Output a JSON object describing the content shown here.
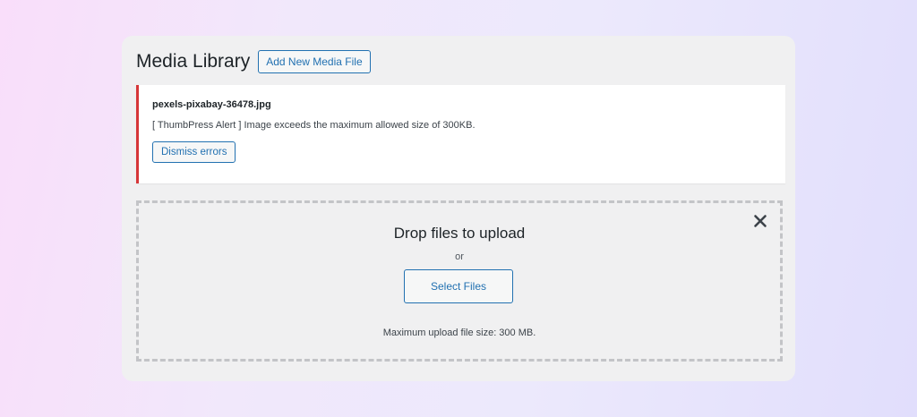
{
  "header": {
    "title": "Media Library",
    "add_new_label": "Add New Media File"
  },
  "notice": {
    "filename": "pexels-pixabay-36478.jpg",
    "message": "[ ThumbPress Alert ] Image exceeds the maximum allowed size of 300KB.",
    "dismiss_label": "Dismiss errors",
    "border_color": "#d63638"
  },
  "uploader": {
    "title": "Drop files to upload",
    "or_text": "or",
    "select_label": "Select Files",
    "max_size_text": "Maximum upload file size: 300 MB.",
    "close_icon": "close-icon"
  },
  "colors": {
    "accent": "#2271b1",
    "panel_bg": "#f0f0f1",
    "error": "#d63638"
  }
}
